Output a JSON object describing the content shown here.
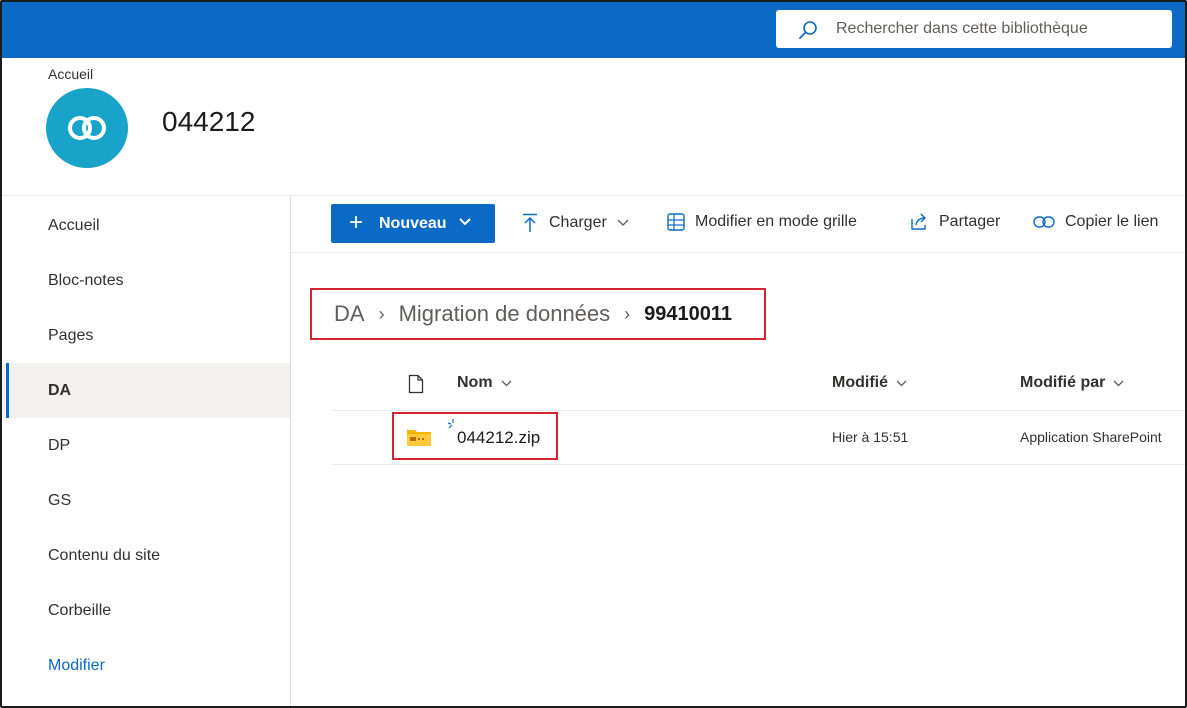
{
  "search": {
    "placeholder": "Rechercher dans cette bibliothèque"
  },
  "site": {
    "breadcrumb": "Accueil",
    "title": "044212"
  },
  "nav": {
    "items": [
      {
        "label": "Accueil"
      },
      {
        "label": "Bloc-notes"
      },
      {
        "label": "Pages"
      },
      {
        "label": "DA",
        "active": true
      },
      {
        "label": "DP"
      },
      {
        "label": "GS"
      },
      {
        "label": "Contenu du site"
      },
      {
        "label": "Corbeille"
      },
      {
        "label": "Modifier",
        "link": true
      }
    ]
  },
  "commands": {
    "new": "Nouveau",
    "upload": "Charger",
    "grid": "Modifier en mode grille",
    "share": "Partager",
    "copy_link": "Copier le lien"
  },
  "breadcrumb": {
    "items": [
      "DA",
      "Migration de données"
    ],
    "current": "99410011"
  },
  "list": {
    "columns": {
      "name": "Nom",
      "modified": "Modifié",
      "modified_by": "Modifié par"
    },
    "rows": [
      {
        "name": "044212.zip",
        "modified": "Hier à 15:51",
        "modified_by": "Application SharePoint"
      }
    ]
  },
  "colors": {
    "accent": "#0b6ac5",
    "highlight": "#d0262f",
    "logo": "#18a4c8",
    "folder": "#f4b400"
  }
}
